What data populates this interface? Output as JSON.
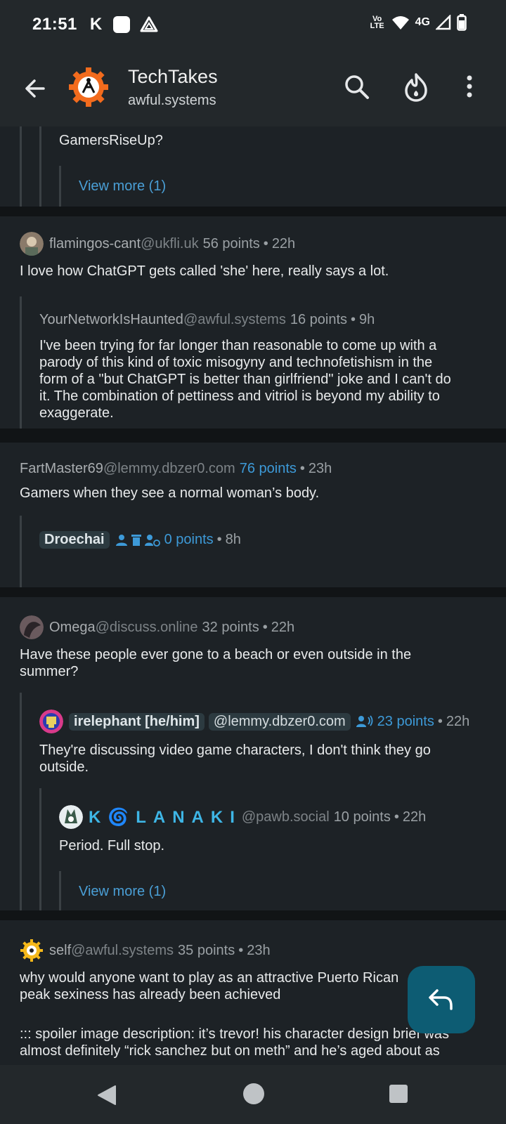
{
  "status_bar": {
    "time": "21:51",
    "carrier_letter": "K",
    "volte": "Vo LTE",
    "network": "4G"
  },
  "app_bar": {
    "title": "TechTakes",
    "subtitle": "awful.systems",
    "icons": [
      "back-arrow-icon",
      "community-logo",
      "search-icon",
      "fire-sort-icon",
      "more-vert-icon"
    ]
  },
  "comments": [
    {
      "text": "GamersRiseUp?",
      "view_more": "View more (1)"
    },
    {
      "user": "flamingos-cant",
      "instance": "@ukfli.uk",
      "points": "56 points",
      "age": "22h",
      "text": "I love how ChatGPT gets called 'she' here, really says a lot.",
      "reply": {
        "user": "YourNetworkIsHaunted",
        "instance": "@awful.systems",
        "points": "16 points",
        "age": "9h",
        "lines": [
          "I've been trying for far longer than reasonable to come up with a",
          "parody of this kind of toxic misogyny and technofetishism in the",
          "form of a \"but ChatGPT is better than girlfriend\" joke and I can't do",
          "it. The combination of pettiness and vitriol is beyond my ability to",
          "exaggerate."
        ]
      }
    },
    {
      "user": "FartMaster69",
      "instance": "@lemmy.dbzer0.com",
      "points": "76 points",
      "age": "23h",
      "text": "Gamers when they see a normal woman’s body.",
      "reply": {
        "user": "Droechai",
        "points": "0 points",
        "age": "8h"
      }
    },
    {
      "user": "Omega",
      "instance": "@discuss.online",
      "points": "32 points",
      "age": "22h",
      "lines": [
        "Have these people ever gone to a beach or even outside in the",
        "summer?"
      ],
      "reply": {
        "user": "irelephant [he/him]",
        "instance": "@lemmy.dbzer0.com",
        "points": "23 points",
        "age": "22h",
        "lines": [
          "They're discussing video game characters, I don't think they go",
          "outside."
        ],
        "reply": {
          "user": "K🌀LANAKI",
          "instance": "@pawb.social",
          "points": "10 points",
          "age": "22h",
          "text": "Period. Full stop.",
          "view_more": "View more (1)"
        }
      }
    },
    {
      "user": "self",
      "instance": "@awful.systems",
      "points": "35 points",
      "age": "23h",
      "lines": [
        "why would anyone want to play as an attractive Puerto Rican",
        "peak sexiness has already been achieved"
      ],
      "spoiler_lines": [
        "::: spoiler image description: it’s trevor! his character design brief was",
        "almost definitely “rick sanchez but on meth” and he’s aged about as"
      ]
    }
  ],
  "fab": {
    "icon": "reply-icon"
  },
  "nav_bar": {
    "icons": [
      "nav-back-icon",
      "nav-home-icon",
      "nav-recents-icon"
    ]
  },
  "colors": {
    "accent": "#3d9ad8",
    "fab": "#0d5c73",
    "card": "#1d2226",
    "bar": "#23282b"
  }
}
